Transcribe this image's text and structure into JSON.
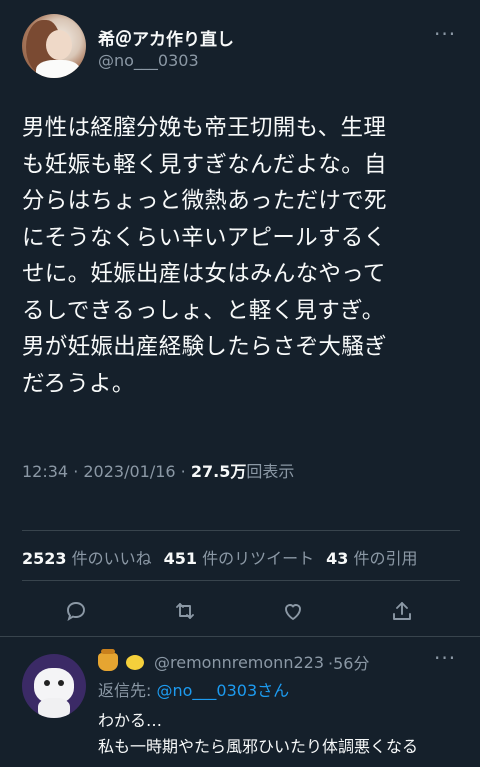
{
  "tweet": {
    "author_name": "希＠アカ作り直し",
    "author_handle": "@no___0303",
    "body": "男性は経膣分娩も帝王切開も、生理\nも妊娠も軽く見すぎなんだよな。自\n分らはちょっと微熱あっただけで死\nにそうなくらい辛いアピールするく\nせに。妊娠出産は女はみんなやって\nるしできるっしょ、と軽く見すぎ。\n男が妊娠出産経験したらさぞ大騒ぎ\nだろうよ。",
    "time": "12:34 · 2023/01/16 · ",
    "views_count": "27.5万",
    "views_label": "回表示"
  },
  "stats": {
    "likes_count": "2523",
    "likes_label": "件のいいね",
    "retweets_count": "451",
    "retweets_label": "件のリツイート",
    "quotes_count": "43",
    "quotes_label": "件の引用"
  },
  "actions": [
    "reply-icon",
    "retweet-icon",
    "like-icon",
    "share-icon"
  ],
  "reply": {
    "handle": "@remonnremonn223",
    "time": "·56分",
    "reply_to_label": "返信先: ",
    "reply_to_handle": "@no___0303",
    "reply_to_suffix": "さん",
    "text": "わかる…\n私も一時期やたら風邪ひいたり体調悪くなる"
  },
  "colors": {
    "background": "#15202b",
    "text": "#f7f9f9",
    "secondary": "#8b98a5",
    "link": "#1d9bf0",
    "divider": "#38444d"
  }
}
